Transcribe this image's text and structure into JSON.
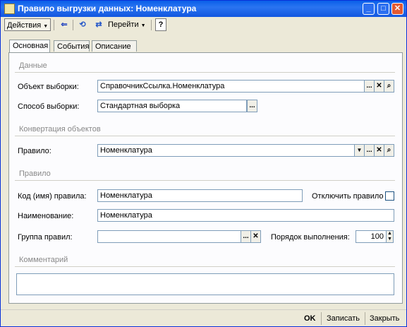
{
  "window": {
    "title": "Правило выгрузки данных: Номенклатура"
  },
  "toolbar": {
    "actions_label": "Действия",
    "goto_label": "Перейти",
    "help_label": "?"
  },
  "tabs": [
    {
      "label": "Основная",
      "active": true
    },
    {
      "label": "События",
      "active": false
    },
    {
      "label": "Описание",
      "active": false
    }
  ],
  "sections": {
    "data": "Данные",
    "conversion": "Конвертация объектов",
    "rule": "Правило",
    "comment": "Комментарий"
  },
  "fields": {
    "selection_object": {
      "label": "Объект выборки:",
      "value": "СправочникСсылка.Номенклатура"
    },
    "selection_method": {
      "label": "Способ выборки:",
      "value": "Стандартная выборка"
    },
    "rule": {
      "label": "Правило:",
      "value": "Номенклатура"
    },
    "rule_code": {
      "label": "Код (имя) правила:",
      "value": "Номенклатура"
    },
    "disable_rule": {
      "label": "Отключить правило",
      "checked": false
    },
    "name": {
      "label": "Наименование:",
      "value": "Номенклатура"
    },
    "rule_group": {
      "label": "Группа правил:",
      "value": ""
    },
    "order": {
      "label": "Порядок выполнения:",
      "value": "100"
    },
    "comment": {
      "value": ""
    }
  },
  "buttons": {
    "ok": "OK",
    "save": "Записать",
    "close": "Закрыть",
    "select": "...",
    "clear": "✕",
    "open": "🔍",
    "dropdown": "▼"
  }
}
